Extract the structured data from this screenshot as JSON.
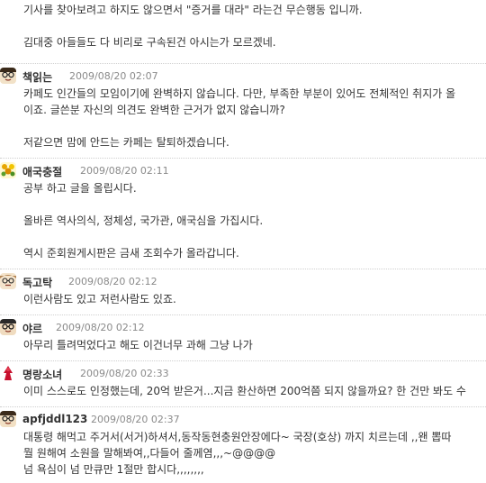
{
  "continuation": {
    "lines": [
      "기사를 찾아보려고 하지도 않으면서 \"증거를 대라\" 라는건 무슨행동 입니까.",
      "",
      "김대중 아들들도 다 비리로 구속된건 아시는가 모르겠네."
    ]
  },
  "comments": [
    {
      "author": "책읽는",
      "date": "2009/08/20 02:07",
      "avatar_icon": "glasses-face-icon",
      "lines": [
        "카페도 인간들의 모임이기에 완벽하지 않습니다. 다만, 부족한 부분이 있어도 전체적인 취지가 올",
        "이죠. 글쓴분 자신의 의견도 완벽한 근거가 없지 않습니까?",
        "",
        "저같으면 맘에 안드는 카페는 탈퇴하겠습니다."
      ]
    },
    {
      "author": "애국충절",
      "date": "2009/08/20 02:11",
      "avatar_icon": "flower-icon",
      "lines": [
        "공부 하고 글을 올립시다.",
        "",
        "올바른 역사의식, 정체성, 국가관, 애국심을 가집시다.",
        "",
        "역시 준회원게시판은 금새 조회수가 올라갑니다."
      ]
    },
    {
      "author": "독고탁",
      "date": "2009/08/20 02:12",
      "avatar_icon": "glasses-face-icon",
      "lines": [
        "이런사람도 있고 저런사람도 있죠."
      ]
    },
    {
      "author": "야르",
      "date": "2009/08/20 02:12",
      "avatar_icon": "glasses-face-icon",
      "lines": [
        "아무리 틀려먹었다고 해도 이건너무 과해 그냥 나가"
      ]
    },
    {
      "author": "명랑소녀",
      "date": "2009/08/20 02:33",
      "avatar_icon": "red-figure-icon",
      "lines": [
        "이미 스스로도 인정했는데, 20억 받은거...지금 환산하면 200억쯤 되지 않을까요? 한 건만 봐도 수"
      ]
    },
    {
      "author": "apfjddl123",
      "date": "2009/08/20 02:37",
      "avatar_icon": "glasses-face-icon",
      "lines": [
        "대통령 해먹고 주거서(서거)하셔서,동작동현충원안장에다~ 국장(호상) 까지 치르는데 ,,왠 뽑따",
        "뭘 원해여 소원을 말해봐여,,다들어 줄께염,,,~@@@@",
        "넘 욕심이 넘 만큐만 1절만 합시다,,,,,,,,"
      ]
    }
  ]
}
